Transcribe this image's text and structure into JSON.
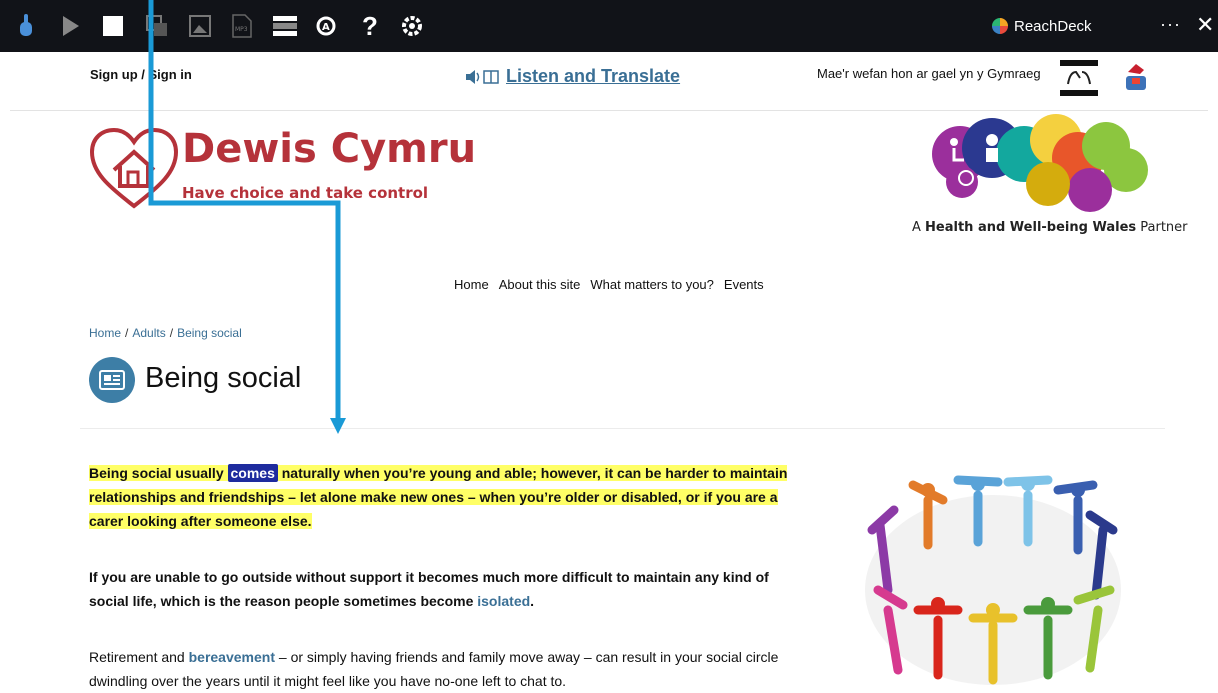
{
  "toolbar": {
    "icons": [
      "hand-pointer-icon",
      "play-icon",
      "stop-icon",
      "translate-icon",
      "picture-icon",
      "mp3-icon",
      "screen-mask-icon",
      "magnifier-icon",
      "help-icon",
      "settings-icon"
    ],
    "help_glyph": "?",
    "mp3_text": "MP3",
    "brand": "ReachDeck",
    "more": "···",
    "close": "✕"
  },
  "header": {
    "signup": "Sign up / Sign in",
    "listen": "Listen and Translate",
    "welsh": "Mae'r wefan hon ar gael yn y Gymraeg"
  },
  "logo": {
    "title": "Dewis Cymru",
    "tagline": "Have choice and take control"
  },
  "partner": {
    "prefix": "A ",
    "bold": "Health and Well-being Wales",
    "suffix": " Partner"
  },
  "nav": [
    "Home",
    "About this site",
    "What matters to you?",
    "Events"
  ],
  "breadcrumb": [
    "Home",
    "Adults",
    "Being social"
  ],
  "page": {
    "title": "Being social"
  },
  "content": {
    "p1_a": "Being social usually ",
    "p1_current": "comes",
    "p1_b": " naturally when you’re young and able; however, it can be harder to maintain relationships and friendships – let alone make new ones – when you’re older or disabled, or if you are a carer looking after someone else.",
    "p2_a": "If you are unable to go outside without support it becomes much more difficult to maintain any kind of social life, which is the reason people sometimes become ",
    "p2_link": "isolated",
    "p2_b": ".",
    "p3_a": "Retirement and ",
    "p3_link": "bereavement",
    "p3_b": " – or simply having friends and family move away – can result in your social circle dwindling over the years until it might feel like you have no-one left to chat to."
  },
  "colors": {
    "toolbar": "#111318",
    "brand_red": "#b5323a",
    "link": "#3a6f95",
    "highlight": "#ffff66",
    "current_word": "#1e2b9e",
    "arrow": "#1a9ad6"
  }
}
